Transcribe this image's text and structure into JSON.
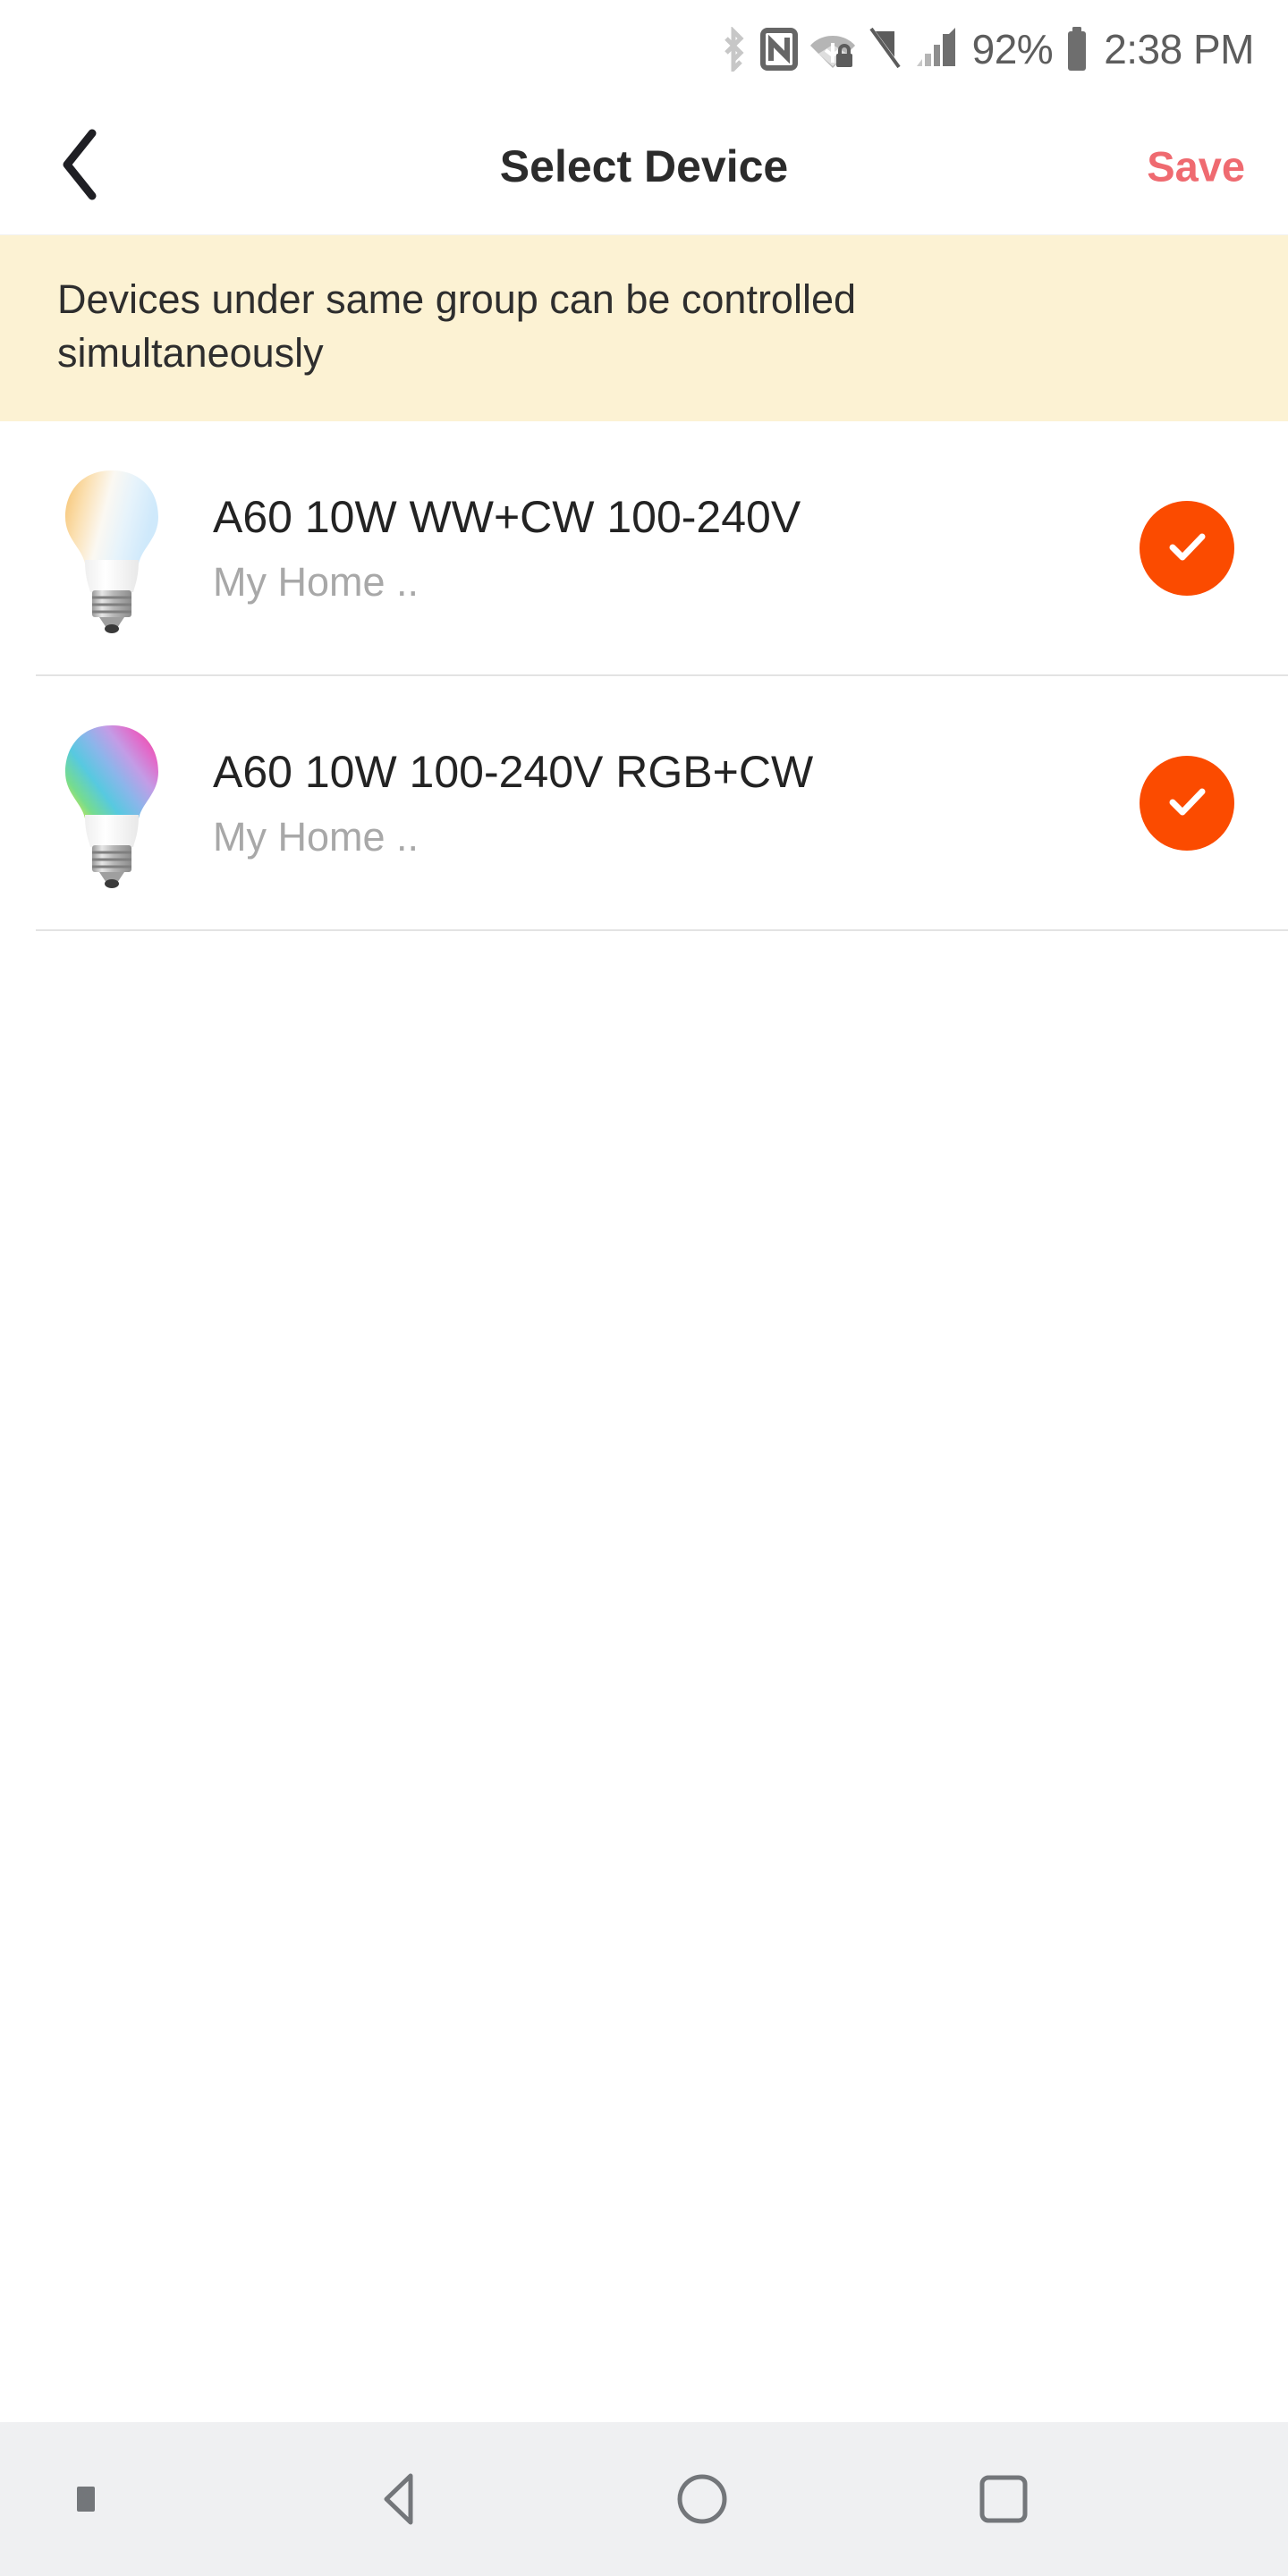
{
  "status_bar": {
    "icons": [
      "bluetooth-icon",
      "nfc-icon",
      "wifi-secured-icon",
      "sim-off-icon",
      "cellular-signal-icon"
    ],
    "battery_percent": "92%",
    "battery_icon": "battery-icon",
    "time": "2:38 PM"
  },
  "header": {
    "back_icon": "chevron-left-icon",
    "title": "Select Device",
    "save_label": "Save",
    "save_color": "#EF6A70"
  },
  "notice": {
    "text": "Devices under same group can be controlled simultaneously",
    "background_color": "#FCF2D3"
  },
  "devices": [
    {
      "name": "A60 10W WW+CW 100-240V",
      "location": "My Home ..",
      "icon": "light-bulb-warm-cool-icon",
      "selected": true,
      "check_icon": "check-icon"
    },
    {
      "name": "A60 10W 100-240V RGB+CW",
      "location": "My Home ..",
      "icon": "light-bulb-rgb-icon",
      "selected": true,
      "check_icon": "check-icon"
    }
  ],
  "theme": {
    "accent_color": "#FB4B00",
    "title_color": "#232323",
    "subtitle_color": "#A8A8A8"
  },
  "nav_bar": {
    "background_color": "#EFF0F2",
    "items": [
      {
        "icon": "keyboard-indicator-icon",
        "label": ""
      },
      {
        "icon": "back-triangle-icon",
        "label": ""
      },
      {
        "icon": "home-circle-icon",
        "label": ""
      },
      {
        "icon": "recents-square-icon",
        "label": ""
      }
    ]
  }
}
